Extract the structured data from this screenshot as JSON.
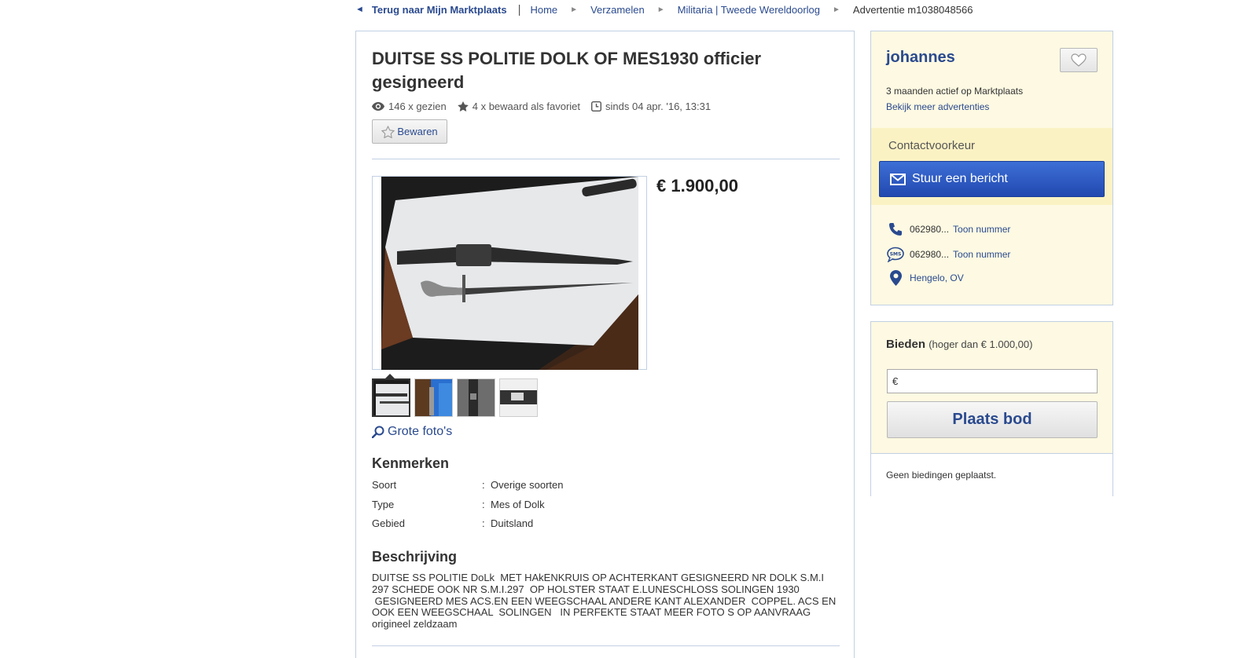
{
  "breadcrumb": {
    "back_label": "Terug naar Mijn Marktplaats",
    "items": [
      "Home",
      "Verzamelen",
      "Militaria | Tweede Wereldoorlog"
    ],
    "current": "Advertentie m1038048566"
  },
  "ad": {
    "title": "DUITSE SS POLITIE DOLK OF MES1930 officier gesigneerd",
    "views": "146 x gezien",
    "favorites": "4 x bewaard als favoriet",
    "since": "sinds 04 apr. '16, 13:31",
    "save_label": "Bewaren",
    "price": "€ 1.900,00",
    "big_photos_label": "Grote foto's",
    "thumbnail_count": 4,
    "features_title": "Kenmerken",
    "features": [
      {
        "key": "Soort",
        "value": "Overige soorten"
      },
      {
        "key": "Type",
        "value": "Mes of Dolk"
      },
      {
        "key": "Gebied",
        "value": "Duitsland"
      }
    ],
    "description_title": "Beschrijving",
    "description": "DUITSE SS POLITIE DoLk  MET HAkENKRUIS OP ACHTERKANT GESIGNEERD NR DOLK S.M.I\n297 SCHEDE OOK NR S.M.I.297  OP HOLSTER STAAT E.LUNESCHLOSS SOLINGEN 1930\n GESIGNEERD MES ACS.EN EEN WEEGSCHAAL ANDERE KANT ALEXANDER  COPPEL. ACS EN\nOOK EEN WEEGSCHAAL  SOLINGEN   IN PERFEKTE STAAT MEER FOTO S OP AANVRAAG\norigineel zeldzaam"
  },
  "seller": {
    "name": "johannes",
    "active": "3 maanden actief op Marktplaats",
    "more_ads": "Bekijk meer advertenties",
    "contact_label": "Contactvoorkeur",
    "message_button": "Stuur een bericht",
    "phone": "062980...",
    "sms": "062980...",
    "show_number": "Toon nummer",
    "location": "Hengelo, OV"
  },
  "bid": {
    "title": "Bieden",
    "subtitle": "(hoger dan € 1.000,00)",
    "input_value": "€",
    "button": "Plaats bod",
    "none": "Geen biedingen geplaatst."
  },
  "colors": {
    "link": "#2a4a8f",
    "border": "#c2d0e3",
    "sidebar_bg": "#fdf9e2",
    "contact_band": "#fbf2c4",
    "primary_button": "#2a55c4"
  }
}
